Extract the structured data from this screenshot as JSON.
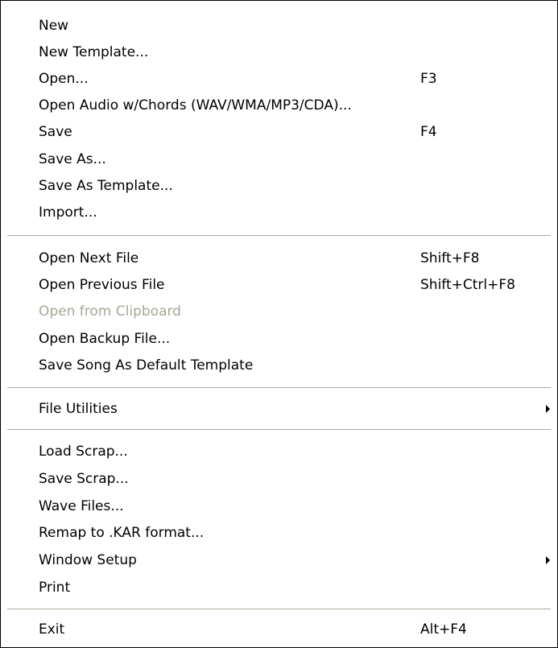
{
  "menu": {
    "items": [
      {
        "label": "New",
        "shortcut": ""
      },
      {
        "label": "New Template...",
        "shortcut": ""
      },
      {
        "label": "Open...",
        "shortcut": "F3"
      },
      {
        "label": "Open Audio w/Chords (WAV/WMA/MP3/CDA)...",
        "shortcut": ""
      },
      {
        "label": "Save",
        "shortcut": "F4"
      },
      {
        "label": "Save As...",
        "shortcut": ""
      },
      {
        "label": "Save As Template...",
        "shortcut": ""
      },
      {
        "label": "Import...",
        "shortcut": ""
      },
      {
        "label": "Open Next File",
        "shortcut": "Shift+F8"
      },
      {
        "label": "Open Previous File",
        "shortcut": "Shift+Ctrl+F8"
      },
      {
        "label": "Open from Clipboard",
        "shortcut": "",
        "disabled": true
      },
      {
        "label": "Open Backup File...",
        "shortcut": ""
      },
      {
        "label": "Save Song As Default Template",
        "shortcut": ""
      },
      {
        "label": "File Utilities",
        "shortcut": "",
        "submenu": true,
        "icon": "submenu-arrow-icon"
      },
      {
        "label": "Load Scrap...",
        "shortcut": ""
      },
      {
        "label": "Save Scrap...",
        "shortcut": ""
      },
      {
        "label": "Wave Files...",
        "shortcut": ""
      },
      {
        "label": "Remap to .KAR format...",
        "shortcut": ""
      },
      {
        "label": "Window Setup",
        "shortcut": "",
        "submenu": true,
        "icon": "submenu-arrow-icon"
      },
      {
        "label": "Print",
        "shortcut": ""
      },
      {
        "label": "Exit",
        "shortcut": "Alt+F4"
      }
    ]
  },
  "colors": {
    "text": "#000000",
    "disabled_text": "#a8a598",
    "separator": "#aca899",
    "background": "#ffffff"
  }
}
